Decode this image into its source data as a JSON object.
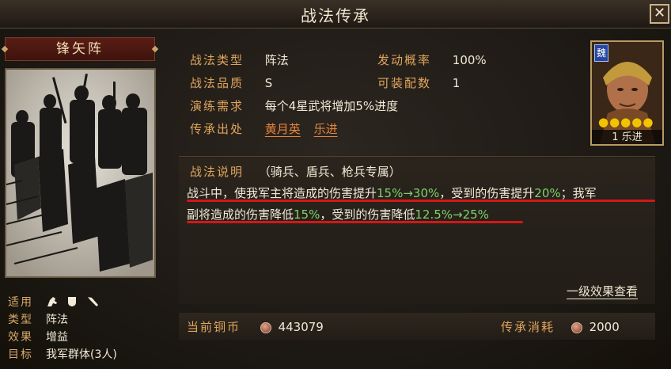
{
  "window": {
    "title": "战法传承",
    "close_label": "✕"
  },
  "card": {
    "name": "锋矢阵",
    "info": [
      {
        "key": "适用",
        "value": "",
        "icons": [
          "cavalry-icon",
          "shield-icon",
          "spear-icon"
        ]
      },
      {
        "key": "类型",
        "value": "阵法"
      },
      {
        "key": "效果",
        "value": "增益"
      },
      {
        "key": "目标",
        "value": "我军群体(3人)"
      }
    ]
  },
  "props": {
    "type_label": "战法类型",
    "type_value": "阵法",
    "rate_label": "发动概率",
    "rate_value": "100%",
    "quality_label": "战法品质",
    "quality_value": "S",
    "slots_label": "可装配数",
    "slots_value": "1",
    "drill_label": "演练需求",
    "drill_value": "每个4星武将增加5%进度",
    "source_label": "传承出处",
    "source_1": "黄月英",
    "source_2": "乐进"
  },
  "description": {
    "title": "战法说明",
    "troops": "（骑兵、盾兵、枪兵专属）",
    "line1_a": "战斗中，使我军主将造成的伤害提升",
    "line1_b": "15%→30%",
    "line1_c": "，受到的伤害提升",
    "line1_d": "20%",
    "line1_e": "；我军",
    "line2_a": "副将造成的伤害降低",
    "line2_b": "15%",
    "line2_c": "，受到的伤害降低",
    "line2_d": "12.5%→25%"
  },
  "first_level_link": "一级效果查看",
  "coins": {
    "current_label": "当前铜币",
    "current_value": "443079",
    "cost_label": "传承消耗",
    "cost_value": "2000"
  },
  "portrait": {
    "faction": "魏",
    "stars": "●●●●●",
    "level": "1",
    "name": "乐进"
  },
  "colors": {
    "accent": "#e0a55c",
    "highlight": "#7bd36a",
    "link": "#e8843a",
    "underline": "#d21818"
  }
}
